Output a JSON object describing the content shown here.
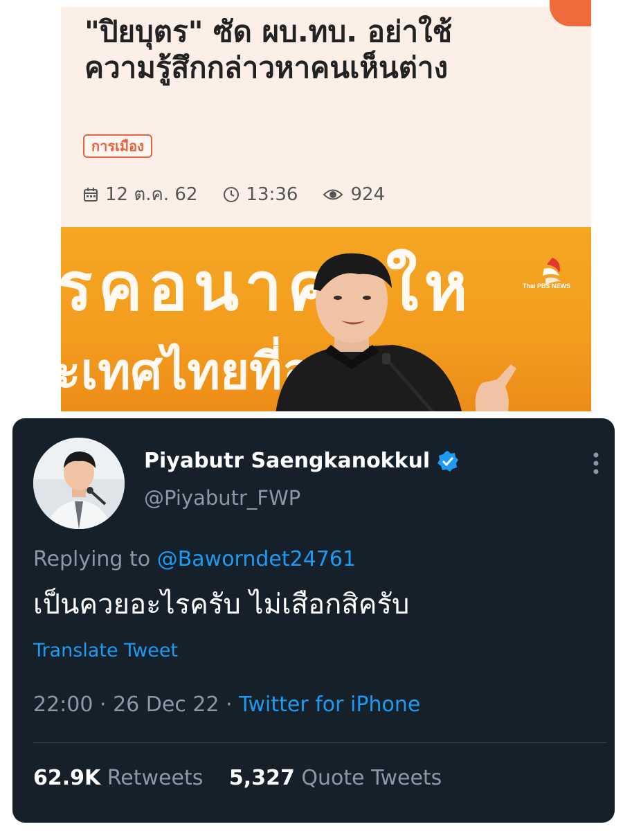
{
  "news": {
    "title_line1": "\"ปิยบุตร\" ซัด ผบ.ทบ. อย่าใช้",
    "title_line2": "ความรู้สึกกล่าวหาคนเห็นต่าง",
    "tag": "การเมือง",
    "date": "12 ต.ค. 62",
    "time": "13:36",
    "views": "924",
    "accent_color": "#e8603c",
    "card_bg": "#fcefe8",
    "photo": {
      "bg_text_top": "รคอนาคตให",
      "bg_text_bottom": "ะเทศไทยที่อนาคต",
      "logo_text": "Thai PBS NEWS",
      "bg_color": "#f5a623"
    }
  },
  "tweet": {
    "display_name": "Piyabutr Saengkanokkul",
    "handle": "@Piyabutr_FWP",
    "replying_prefix": "Replying to",
    "replying_to": "@Baworndet24761",
    "text": "เป็นควยอะไรครับ ไม่เสือกสิครับ",
    "translate_label": "Translate Tweet",
    "timestamp": "22:00 · 26 Dec 22 ·",
    "source": "Twitter for iPhone",
    "stats": [
      {
        "value": "62.9K",
        "label": "Retweets"
      },
      {
        "value": "5,327",
        "label": "Quote Tweets"
      }
    ],
    "bg_color": "#15202b",
    "link_color": "#1d9bf0",
    "muted_color": "#8b98a5"
  }
}
